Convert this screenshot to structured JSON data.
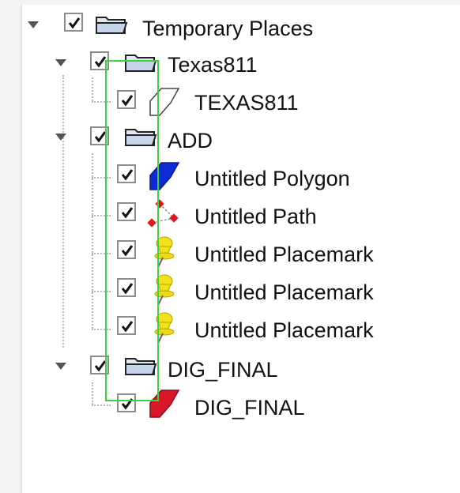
{
  "tree": {
    "root": {
      "label": "Temporary Places",
      "checked": true,
      "expanded": true,
      "icon": "folder-icon"
    },
    "groups": [
      {
        "label": "Texas811",
        "checked": true,
        "expanded": true,
        "icon": "folder-icon",
        "children": [
          {
            "label": "TEXAS811",
            "checked": true,
            "icon": "outline-polygon-icon"
          }
        ]
      },
      {
        "label": "ADD",
        "checked": true,
        "expanded": true,
        "icon": "folder-icon",
        "children": [
          {
            "label": "Untitled Polygon",
            "checked": true,
            "icon": "blue-polygon-icon"
          },
          {
            "label": "Untitled Path",
            "checked": true,
            "icon": "path-icon"
          },
          {
            "label": "Untitled Placemark",
            "checked": true,
            "icon": "yellow-pushpin-icon"
          },
          {
            "label": "Untitled Placemark",
            "checked": true,
            "icon": "yellow-pushpin-icon"
          },
          {
            "label": "Untitled Placemark",
            "checked": true,
            "icon": "yellow-pushpin-icon"
          }
        ]
      },
      {
        "label": "DIG_FINAL",
        "checked": true,
        "expanded": true,
        "icon": "folder-icon",
        "children": [
          {
            "label": "DIG_FINAL",
            "checked": true,
            "icon": "red-polygon-icon"
          }
        ]
      }
    ]
  },
  "colors": {
    "selection_outline": "#3cd23c",
    "polygon_blue": "#0a2bd6",
    "polygon_red": "#d8182a",
    "pushpin_yellow": "#f3e21a",
    "path_red": "#e01818"
  }
}
